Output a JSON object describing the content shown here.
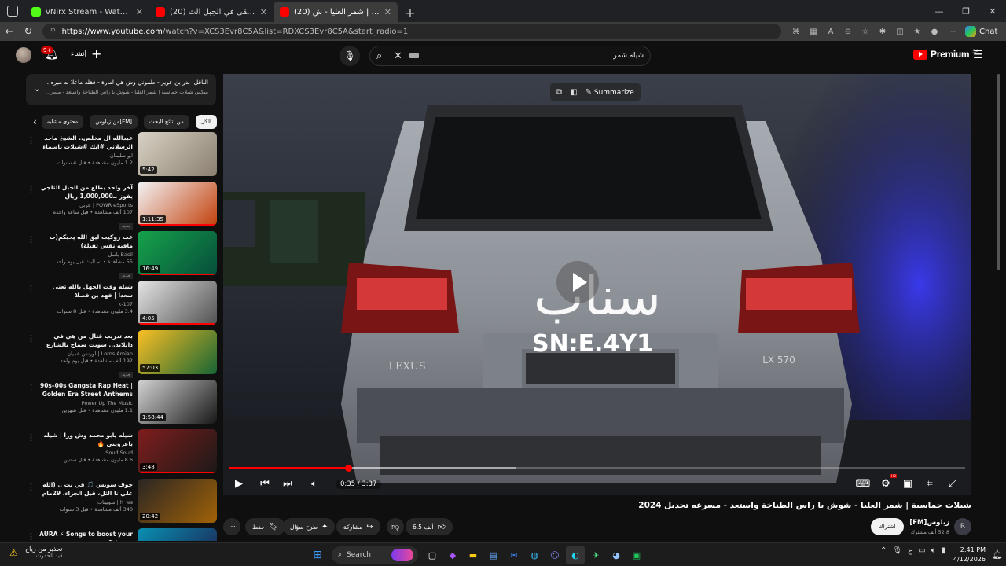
{
  "browser": {
    "tabs": [
      {
        "title": "vNirx Stream - Watch Live on Kick",
        "favicon_color": "#53fc18",
        "active": false
      },
      {
        "title": "(20) آخر واحد يبقى في الجبل الث",
        "favicon_color": "#ff0000",
        "active": false
      },
      {
        "title": "(20) شيلات حماسية | شمر العليا - ش",
        "favicon_color": "#ff0000",
        "active": true
      }
    ],
    "new_tab_icon": "+",
    "url_host": "https://www.youtube.com",
    "url_path": "/watch?v=XCS3Evr8C5A&list=RDXCS3Evr8C5A&start_radio=1",
    "chat_label": "Chat"
  },
  "yt_header": {
    "notification_count": "9+",
    "create_label": "إنشاء",
    "search_query": "شيله شمر",
    "logo_text": "Premium",
    "logo_country": "SA"
  },
  "playlist": {
    "title": "الناقل: بدر بن عوير - طموني وش هي امارة - فقله ماعلا له مبره ركاب",
    "subtitle": "ميكس شيلات حماسية | شمر العليا - شوش يا راس الطناخة واستعد - مسرعه تحديل 4"
  },
  "chips": [
    {
      "label": "الكل",
      "active": true
    },
    {
      "label": "من نتائج البحث",
      "active": false
    },
    {
      "label": "من زيلوس[FM]",
      "active": false
    },
    {
      "label": "محتوى مشابه",
      "active": false
    }
  ],
  "related": [
    {
      "title": "عبدالله ال مخلص.. الشيخ ماجد الرسلاني #ايك #شيلات باسماء",
      "channel": "ابو سليمان",
      "views": "1.2 مليون مشاهدة • قبل 4 سنوات",
      "duration": "5:42",
      "progress": 0,
      "badge": "",
      "thumb": [
        "#d9d2c4",
        "#8a7f70"
      ]
    },
    {
      "title": "آخر واحد يطلع من الجبل الثلجي يفوز بـ1,000,000 ريال",
      "channel": "POWR eSports | عربي",
      "views": "107 ألف مشاهدة • قبل ساعة واحدة",
      "duration": "1:11:35",
      "progress": 100,
      "badge": "جديد",
      "thumb": [
        "#f3f4f6",
        "#c2410c"
      ]
    },
    {
      "title": "عت روكيت ليق الله يحبكم(ت ماقيه نفس تقيلة)",
      "channel": "Basil باسل",
      "views": "55 مشاهدة • تم البث قبل يوم واحد",
      "duration": "16:49",
      "progress": 100,
      "badge": "جديد",
      "thumb": [
        "#16a34a",
        "#064e3b"
      ]
    },
    {
      "title": "شيله وقت الجهل بالله تعنى سعدا | فهد بن فصلا",
      "channel": "k-107",
      "views": "3.4 مليون مشاهدة • قبل 8 سنوات",
      "duration": "4:05",
      "progress": 100,
      "badge": "",
      "thumb": [
        "#e5e5e5",
        "#525252"
      ]
    },
    {
      "title": "بعد تدريب قتال من هي في دايلاند... سويت سماج بالشارع TH",
      "channel": "Lorns Amian | لورنس عميان",
      "views": "192 ألف مشاهدة • قبل يوم واحد",
      "duration": "57:03",
      "progress": 0,
      "badge": "جديد",
      "thumb": [
        "#fbbf24",
        "#166534"
      ]
    },
    {
      "title": "90s–00s Gangsta Rap Heat | Golden Era Street Anthems Only",
      "channel": "Power Up The Music",
      "views": "1.1 مليون مشاهدة • قبل شهرين",
      "duration": "1:58:44",
      "progress": 0,
      "badge": "",
      "thumb": [
        "#d4d4d4",
        "#171717"
      ]
    },
    {
      "title": "شيله يابو محمد وش ورا | شيله باعرويني 🔥",
      "channel": "Soud Soud",
      "views": "8.6 مليون مشاهدة • قبل سنتين",
      "duration": "3:48",
      "progress": 100,
      "badge": "",
      "thumb": [
        "#7f1d1d",
        "#1c1917"
      ]
    },
    {
      "title": "جوف سويس 🎵 في بت .. (الله علي نا الثل، قبل الجزاء، 29مام وتكون معالك، طارق)",
      "channel": "h_ws | سوبينات",
      "views": "340 ألف مشاهدة • قبل 3 سنوات",
      "duration": "20:42",
      "progress": 0,
      "badge": "",
      "thumb": [
        "#292524",
        "#a16207"
      ]
    },
    {
      "title": "AURA ⚡ Songs to boost your confidence",
      "channel": "",
      "views": "",
      "duration": "",
      "progress": 0,
      "badge": "",
      "thumb": [
        "#0891b2",
        "#1e1b4b"
      ]
    }
  ],
  "player": {
    "summarize_label": "Summarize",
    "time_current": "0:35",
    "time_total": "3:37",
    "played_fraction": 0.161,
    "buffered_fraction": 0.39,
    "plate_text": "SN:E.4Y1",
    "watermark": "سناب",
    "car_badge_left": "LEXUS",
    "car_badge_right": "LX 570"
  },
  "video": {
    "title": "شيلات حماسية | شمر العليا - شوش يا راس الطناخة واستعد - مسرعه تحديل 2024",
    "channel_name": "زيلوس[FM]",
    "subscribers": "52.8 ألف مشترك",
    "subscribe_label": "اشتراك",
    "likes": "6.5 ألف",
    "share_label": "مشاركة",
    "ask_label": "طرح سؤال",
    "save_label": "حفظ"
  },
  "taskbar": {
    "weather_line1": "تحذير من رياح",
    "weather_line2": "قيد الحدوث",
    "search_label": "Search",
    "time": "2:41 PM",
    "date": "4/12/2026",
    "lang": "ع"
  }
}
